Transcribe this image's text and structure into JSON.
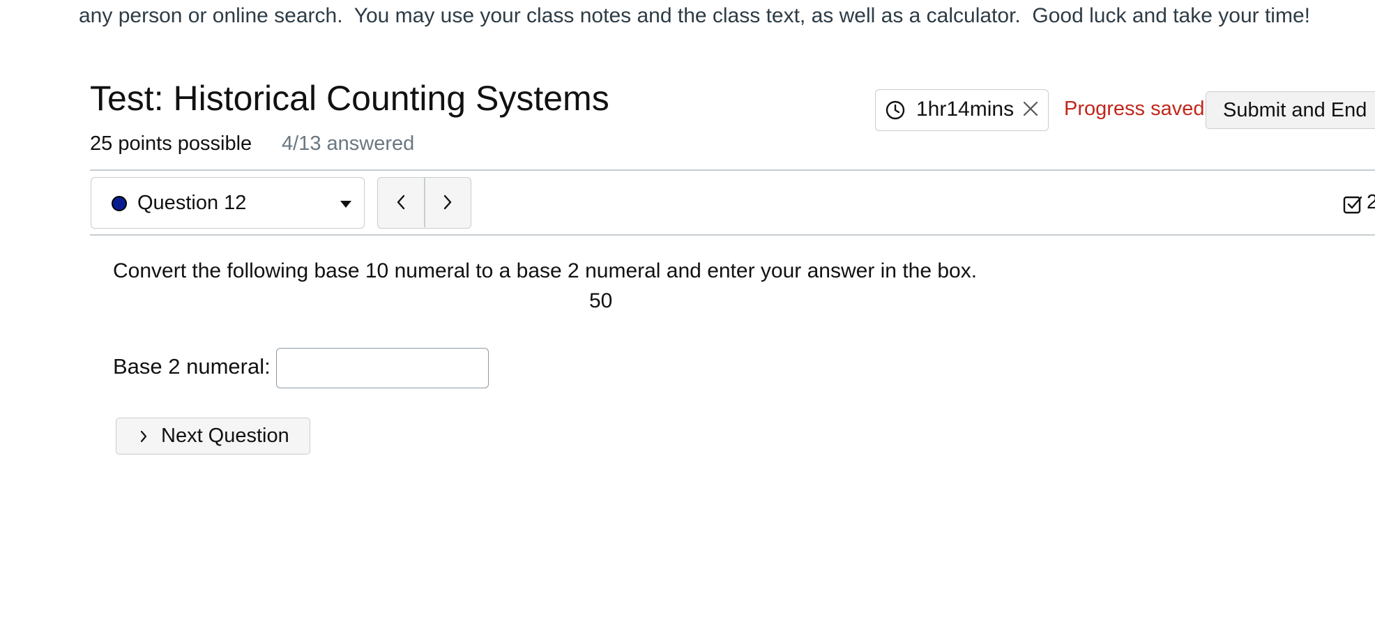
{
  "instructions": {
    "text": "any person or online search.  You may use your class notes and the class text, as well as a calculator.  Good luck and take your time!"
  },
  "header": {
    "title": "Test: Historical Counting Systems",
    "points": "25 points possible",
    "answered": "4/13 answered"
  },
  "timer": {
    "time": "1hr14mins",
    "icon": "clock-icon",
    "close_icon": "close-icon"
  },
  "status": {
    "progress_text": "Progress saved",
    "progress_color": "#c1271b"
  },
  "actions": {
    "submit_label": "Submit and End"
  },
  "question_nav": {
    "selected": "Question 12",
    "dot_color": "#0a1d8f",
    "prev_icon": "chevron-left-icon",
    "next_icon": "chevron-right-icon",
    "check_icon": "checkbox-icon",
    "check_text": "2"
  },
  "question": {
    "prompt": "Convert the following base 10 numeral to a base 2 numeral and enter your answer in the box.",
    "numeral": "50",
    "answer_label": "Base 2 numeral:",
    "answer_value": "",
    "answer_placeholder": "",
    "next_label": "Next Question"
  }
}
